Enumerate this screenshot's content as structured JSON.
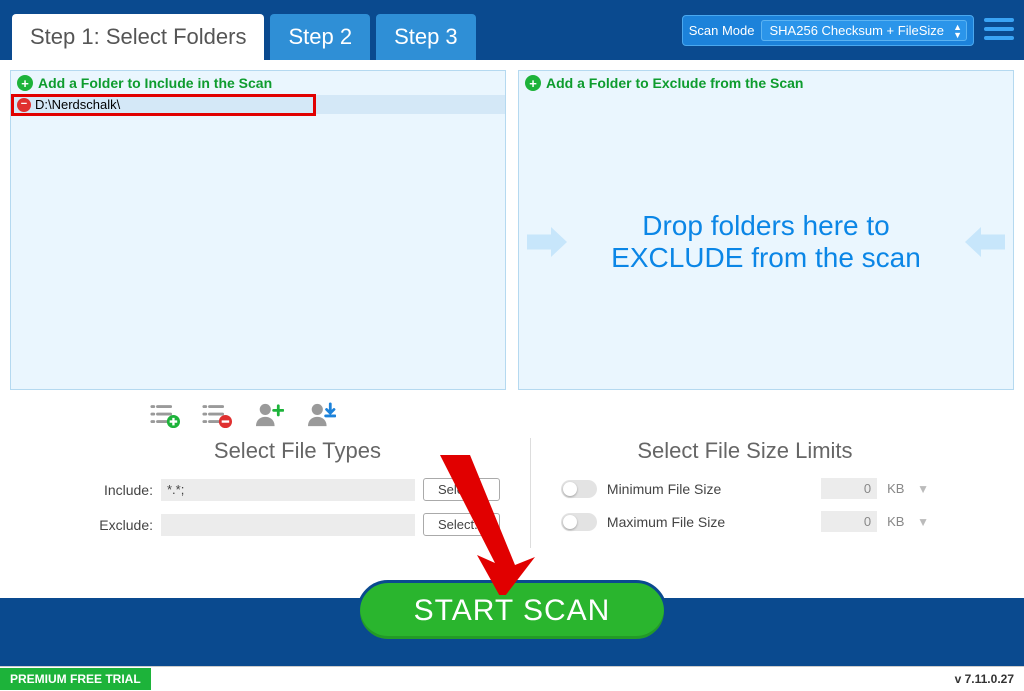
{
  "tabs": {
    "step1": "Step 1: Select Folders",
    "step2": "Step 2",
    "step3": "Step 3"
  },
  "scan_mode": {
    "label": "Scan Mode",
    "selected": "SHA256 Checksum + FileSize"
  },
  "include_panel": {
    "header": "Add a Folder to Include in the Scan",
    "items": [
      "D:\\Nerdschalk\\"
    ]
  },
  "exclude_panel": {
    "header": "Add a Folder to Exclude from the Scan",
    "drop_text": "Drop folders here to EXCLUDE from the scan"
  },
  "file_types": {
    "title": "Select File Types",
    "include_label": "Include:",
    "include_value": "*.*;",
    "exclude_label": "Exclude:",
    "exclude_value": "",
    "select_btn": "Select..."
  },
  "file_sizes": {
    "title": "Select File Size Limits",
    "min_label": "Minimum File Size",
    "max_label": "Maximum File Size",
    "min_value": "0",
    "max_value": "0",
    "unit": "KB"
  },
  "start_scan": "START SCAN",
  "footer": {
    "trial": "PREMIUM FREE TRIAL",
    "version": "v 7.11.0.27"
  }
}
